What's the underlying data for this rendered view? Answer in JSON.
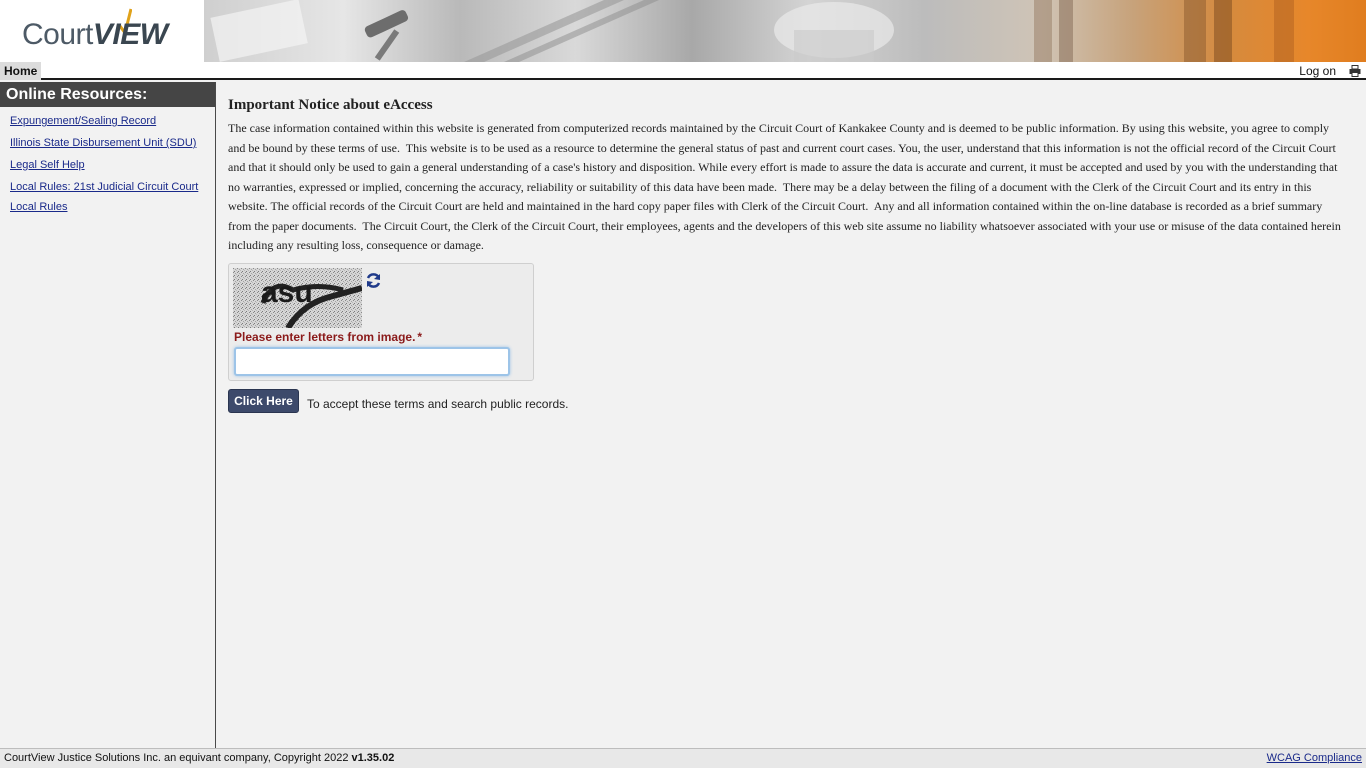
{
  "header": {
    "logo_court": "Court",
    "logo_view": "VIEW"
  },
  "nav": {
    "home": "Home",
    "logon": "Log on"
  },
  "sidebar": {
    "title": "Online Resources:",
    "links": [
      {
        "label": "Expungement/Sealing Record"
      },
      {
        "label": "Illinois State Disbursement Unit (SDU)"
      },
      {
        "label": "Legal Self Help"
      },
      {
        "label": "Local Rules: 21st Judicial Circuit Court Local Rules"
      }
    ]
  },
  "notice": {
    "title": "Important Notice about eAccess",
    "body": "The case information contained within this website is generated from computerized records maintained by the Circuit Court of Kankakee County and is deemed to be public information. By using this website, you agree to comply and be bound by these terms of use.  This website is to be used as a resource to determine the general status of past and current court cases. You, the user, understand that this information is not the official record of the Circuit Court and that it should only be used to gain a general understanding of a case's history and disposition. While every effort is made to assure the data is accurate and current, it must be accepted and used by you with the understanding that no warranties, expressed or implied, concerning the accuracy, reliability or suitability of this data have been made.  There may be a delay between the filing of a document with the Clerk of the Circuit Court and its entry in this website. The official records of the Circuit Court are held and maintained in the hard copy paper files with Clerk of the Circuit Court.  Any and all information contained within the on-line database is recorded as a brief summary from the paper documents.  The Circuit Court, the Clerk of the Circuit Court, their employees, agents and the developers of this web site assume no liability whatsoever associated with your use or misuse of the data contained herein including any resulting loss, consequence or damage."
  },
  "captcha": {
    "label": "Please enter letters from image.",
    "required_marker": "*",
    "input_value": "",
    "image_text": "asu"
  },
  "actions": {
    "button_label": "Click Here",
    "description": "To accept these terms and search public records."
  },
  "footer": {
    "copyright": "CourtView Justice Solutions Inc. an equivant company, Copyright 2022 ",
    "version": "v1.35.02",
    "wcag": "WCAG Compliance"
  },
  "colors": {
    "sidebar_header_bg": "#454545",
    "button_bg": "#3d4a6b",
    "captcha_label": "#8b1a1a",
    "link": "#1a2a8a",
    "banner_accent": "#e07d1f"
  }
}
